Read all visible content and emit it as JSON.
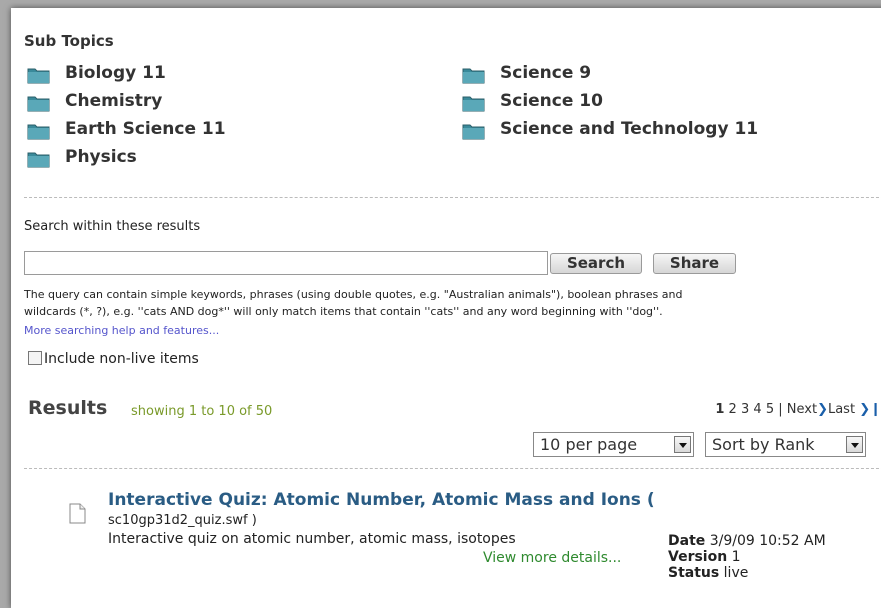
{
  "subtopics": {
    "heading": "Sub Topics",
    "left": [
      "Biology 11",
      "Chemistry",
      "Earth Science 11",
      "Physics"
    ],
    "right": [
      "Science 9",
      "Science 10",
      "Science and Technology 11"
    ]
  },
  "search": {
    "label": "Search within these results",
    "input_value": "",
    "search_button": "Search",
    "share_button": "Share",
    "help_line1": "The query can contain simple keywords, phrases (using double quotes, e.g. \"Australian animals\"), boolean phrases and",
    "help_line2": "wildcards (*, ?), e.g. ''cats AND dog*'' will only match items that contain ''cats'' and any word beginning with ''dog''.",
    "help_link": "More searching help and features...",
    "include_label": "Include non-live items"
  },
  "results": {
    "title": "Results",
    "count_text": "showing 1 to 10 of 50",
    "pager": {
      "current": "1",
      "pages": [
        "2",
        "3",
        "4",
        "5"
      ],
      "separator": "|",
      "next": "Next",
      "last": "Last",
      "next_arrow": "❯",
      "last_arrow": "❯❙"
    },
    "per_page": "10 per page",
    "sort": "Sort by Rank"
  },
  "item": {
    "title": "Interactive Quiz: Atomic Number, Atomic Mass and Ions (",
    "file": "sc10gp31d2_quiz.swf )",
    "description": "Interactive quiz on atomic number, atomic mass, isotopes",
    "more_link": "View more details...",
    "date_label": "Date",
    "date_value": "3/9/09 10:52 AM",
    "version_label": "Version",
    "version_value": "1",
    "status_label": "Status",
    "status_value": "live"
  },
  "colors": {
    "folder": "#3a8a9a",
    "link_blue": "#2a5c84",
    "count_green": "#7a9a2a",
    "more_green": "#2f8a2f"
  }
}
